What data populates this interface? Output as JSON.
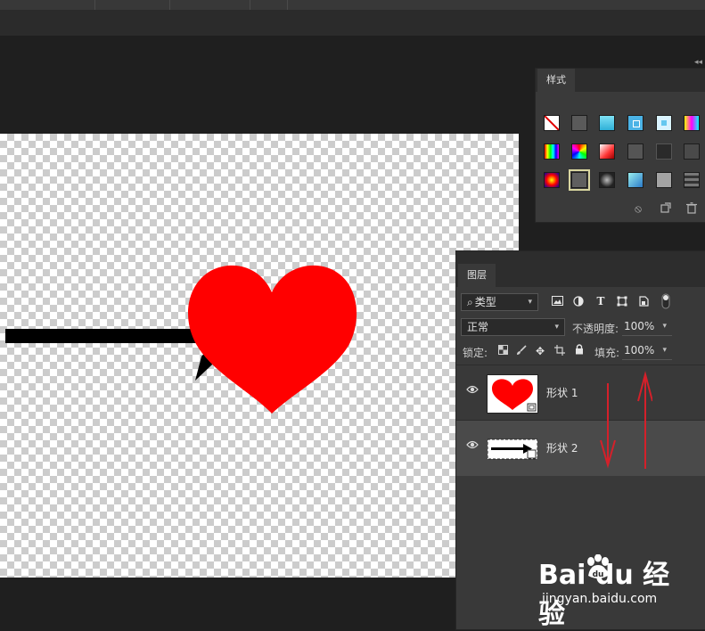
{
  "styles_panel": {
    "tab_label": "样式",
    "collapse_glyph": "◂◂"
  },
  "layers_panel": {
    "tab_label": "图层",
    "filter": {
      "value": "类型",
      "search_glyph": "⌕"
    },
    "blend_mode": {
      "value": "正常"
    },
    "opacity": {
      "label": "不透明度:",
      "value": "100%"
    },
    "lock": {
      "label": "锁定:"
    },
    "fill": {
      "label": "填充:",
      "value": "100%"
    },
    "layers": [
      {
        "name": "形状 1",
        "visible": true,
        "selected": false,
        "thumbnail": "heart-shape"
      },
      {
        "name": "形状 2",
        "visible": true,
        "selected": true,
        "thumbnail": "arrow-shape"
      }
    ]
  },
  "watermark": {
    "brand": "Bai du 经验",
    "url": "jingyan.baidu.com"
  },
  "colors": {
    "heart": "#ff0000",
    "arrow": "#000000",
    "annotation": "#d4202a"
  }
}
